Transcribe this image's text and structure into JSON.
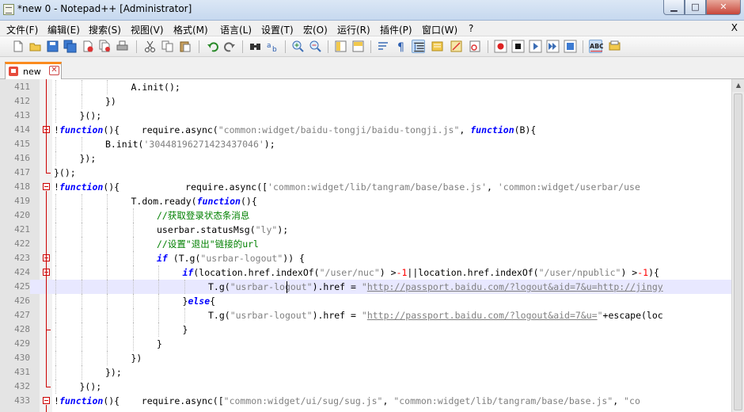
{
  "window": {
    "title": "*new  0 - Notepad++ [Administrator]",
    "minimize_label": "▁",
    "maximize_label": "□",
    "close_label": "✕"
  },
  "menubar": {
    "items": [
      "文件(F)",
      "编辑(E)",
      "搜索(S)",
      "视图(V)",
      "格式(M)",
      "语言(L)",
      "设置(T)",
      "宏(O)",
      "运行(R)",
      "插件(P)",
      "窗口(W)",
      "?"
    ],
    "close_label": "X"
  },
  "toolbar": {
    "icons": [
      "new-file-icon",
      "open-file-icon",
      "save-icon",
      "save-all-icon",
      "close-icon",
      "close-all-icon",
      "print-icon",
      "cut-icon",
      "copy-icon",
      "paste-icon",
      "undo-icon",
      "redo-icon",
      "find-icon",
      "replace-icon",
      "zoom-in-icon",
      "zoom-out-icon",
      "sync-vertical-icon",
      "sync-horizontal-icon",
      "word-wrap-icon",
      "show-all-chars-icon",
      "indent-guide-icon",
      "document-map-icon",
      "function-list-icon",
      "folder-workspace-icon",
      "record-macro-icon",
      "stop-macro-icon",
      "play-macro-icon",
      "run-macro-multiple-icon",
      "save-macro-icon",
      "spell-check-icon",
      "doc-switcher-icon"
    ]
  },
  "tabs": [
    {
      "label": "new",
      "close_label": "✕"
    }
  ],
  "editor": {
    "lines": [
      {
        "num": "411",
        "indent": 3,
        "segments": [
          [
            "A.init();",
            ""
          ]
        ]
      },
      {
        "num": "412",
        "indent": 2,
        "segments": [
          [
            "})",
            ""
          ]
        ]
      },
      {
        "num": "413",
        "indent": 1,
        "segments": [
          [
            "}();",
            ""
          ]
        ]
      },
      {
        "num": "414",
        "indent": 0,
        "segments": [
          [
            "!",
            ""
          ],
          [
            "function",
            "kw"
          ],
          [
            "(){    require.async(",
            ""
          ],
          [
            "\"common:widget/baidu-tongji/baidu-tongji.js\"",
            "str"
          ],
          [
            ", ",
            ""
          ],
          [
            "function",
            "kw"
          ],
          [
            "(B){",
            ""
          ]
        ]
      },
      {
        "num": "415",
        "indent": 2,
        "segments": [
          [
            "B.init(",
            ""
          ],
          [
            "'304481962714234370​46'",
            "str"
          ],
          [
            ");",
            ""
          ]
        ]
      },
      {
        "num": "416",
        "indent": 1,
        "segments": [
          [
            "});",
            ""
          ]
        ]
      },
      {
        "num": "417",
        "indent": 0,
        "segments": [
          [
            "}();",
            ""
          ]
        ]
      },
      {
        "num": "418",
        "indent": 0,
        "segments": [
          [
            "!",
            ""
          ],
          [
            "function",
            "kw"
          ],
          [
            "(){            require.async([",
            ""
          ],
          [
            "'common:widget/lib/tangram/base/base.js'",
            "str"
          ],
          [
            ", ",
            ""
          ],
          [
            "'common:widget/userbar/use",
            "str"
          ]
        ]
      },
      {
        "num": "419",
        "indent": 3,
        "segments": [
          [
            "T.dom.ready(",
            ""
          ],
          [
            "function",
            "kw"
          ],
          [
            "(){",
            ""
          ]
        ]
      },
      {
        "num": "420",
        "indent": 4,
        "segments": [
          [
            "//获取登录状态条消息",
            "cm"
          ]
        ]
      },
      {
        "num": "421",
        "indent": 4,
        "segments": [
          [
            "userbar.statusMsg(",
            ""
          ],
          [
            "\"ly\"",
            "str"
          ],
          [
            ");",
            ""
          ]
        ]
      },
      {
        "num": "422",
        "indent": 4,
        "segments": [
          [
            "//设置\"退出\"链接的url",
            "cm"
          ]
        ]
      },
      {
        "num": "423",
        "indent": 4,
        "segments": [
          [
            "if",
            "kw"
          ],
          [
            " (T.g(",
            ""
          ],
          [
            "\"usrbar-logout\"",
            "str"
          ],
          [
            ")) {",
            ""
          ]
        ]
      },
      {
        "num": "424",
        "indent": 5,
        "segments": [
          [
            "if",
            "kw"
          ],
          [
            "(location.href.indexOf(",
            ""
          ],
          [
            "\"/user/nuc\"",
            "str"
          ],
          [
            ") >",
            ""
          ],
          [
            "-1",
            "num"
          ],
          [
            "||location.href.indexOf(",
            ""
          ],
          [
            "\"/user/npublic\"",
            "str"
          ],
          [
            ") >",
            ""
          ],
          [
            "-1",
            "num"
          ],
          [
            "){",
            ""
          ]
        ]
      },
      {
        "num": "425",
        "indent": 6,
        "segments": [
          [
            "T.g(",
            ""
          ],
          [
            "\"usrbar-logout\"",
            "str"
          ],
          [
            ").href = ",
            ""
          ],
          [
            "\"",
            "str"
          ],
          [
            "http://passport.baidu.com/?logout&aid=7&u=http://jingy",
            "url"
          ]
        ]
      },
      {
        "num": "426",
        "indent": 5,
        "segments": [
          [
            "}",
            ""
          ],
          [
            "else",
            "kw"
          ],
          [
            "{",
            ""
          ]
        ]
      },
      {
        "num": "427",
        "indent": 6,
        "segments": [
          [
            "T.g(",
            ""
          ],
          [
            "\"usrbar-logout\"",
            "str"
          ],
          [
            ").href = ",
            ""
          ],
          [
            "\"",
            "str"
          ],
          [
            "http://passport.baidu.com/?logout&aid=7&u=",
            "url"
          ],
          [
            "\"",
            "str"
          ],
          [
            "+escape(loc",
            ""
          ]
        ]
      },
      {
        "num": "428",
        "indent": 5,
        "segments": [
          [
            "}",
            ""
          ]
        ]
      },
      {
        "num": "429",
        "indent": 4,
        "segments": [
          [
            "}",
            ""
          ]
        ]
      },
      {
        "num": "430",
        "indent": 3,
        "segments": [
          [
            "})",
            ""
          ]
        ]
      },
      {
        "num": "431",
        "indent": 2,
        "segments": [
          [
            "});",
            ""
          ]
        ]
      },
      {
        "num": "432",
        "indent": 1,
        "segments": [
          [
            "}();",
            ""
          ]
        ]
      },
      {
        "num": "433",
        "indent": 0,
        "segments": [
          [
            "!",
            ""
          ],
          [
            "function",
            "kw"
          ],
          [
            "(){    require.async([",
            ""
          ],
          [
            "\"common:widget/ui/sug/sug.js\"",
            "str"
          ],
          [
            ", ",
            ""
          ],
          [
            "\"common:widget/lib/tangram/base/base.js\"",
            "str"
          ],
          [
            ", ",
            ""
          ],
          [
            "\"co",
            "str"
          ]
        ]
      }
    ],
    "current_line": "425"
  }
}
